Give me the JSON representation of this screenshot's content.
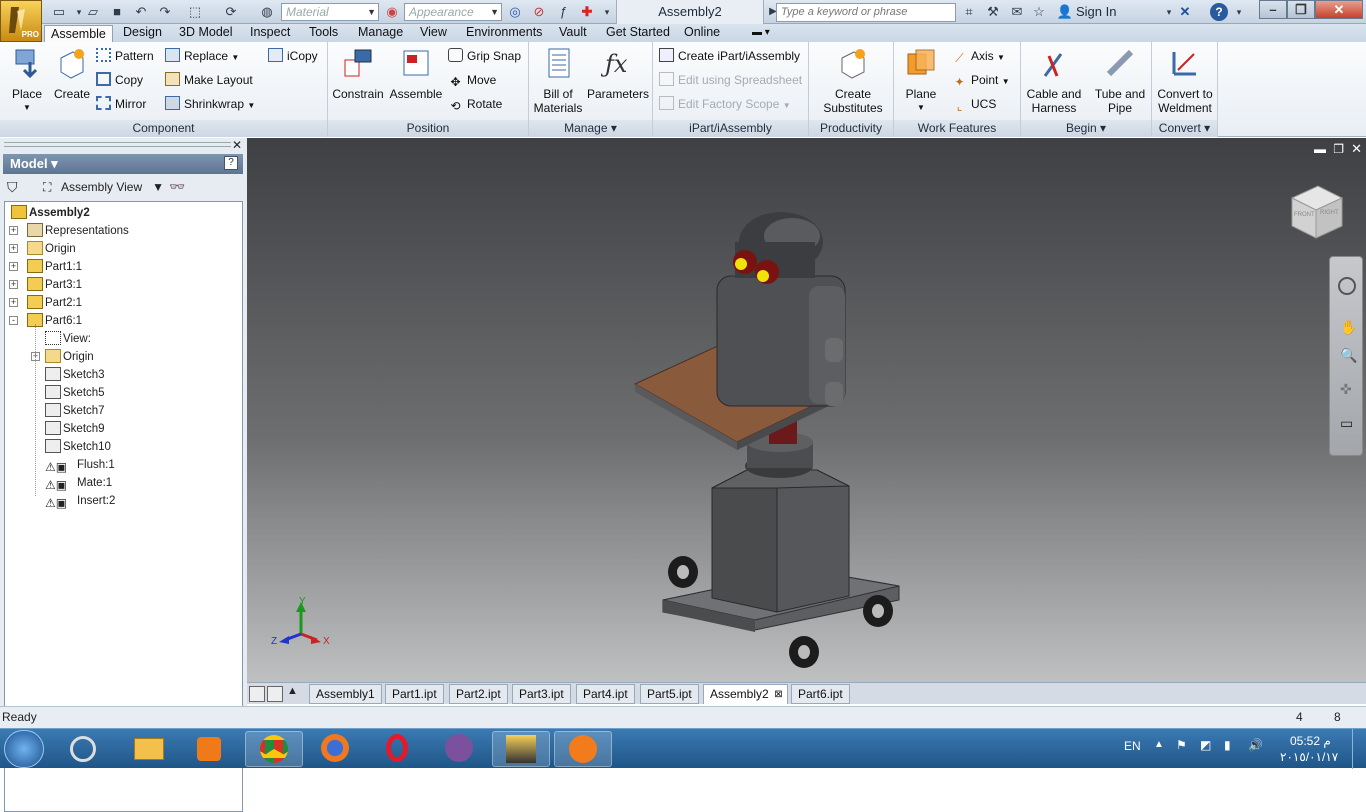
{
  "app": {
    "badge": "PRO"
  },
  "titlebar": {
    "material_placeholder": "Material",
    "appearance_placeholder": "Appearance",
    "document_title": "Assembly2",
    "search_placeholder": "Type a keyword or phrase",
    "sign_in": "Sign In",
    "help": "?"
  },
  "menu_tabs": [
    "Assemble",
    "Design",
    "3D Model",
    "Inspect",
    "Tools",
    "Manage",
    "View",
    "Environments",
    "Vault",
    "Get Started",
    "Online"
  ],
  "active_tab": "Assemble",
  "ribbon": {
    "component": {
      "title": "Component",
      "place": "Place",
      "create": "Create",
      "pattern": "Pattern",
      "copy": "Copy",
      "mirror": "Mirror",
      "replace": "Replace",
      "make_layout": "Make Layout",
      "shrinkwrap": "Shrinkwrap",
      "icopy": "iCopy"
    },
    "position": {
      "title": "Position",
      "constrain": "Constrain",
      "assemble": "Assemble",
      "grip_snap": "Grip Snap",
      "move": "Move",
      "rotate": "Rotate"
    },
    "manage": {
      "title": "Manage",
      "bom_line1": "Bill of",
      "bom_line2": "Materials",
      "parameters": "Parameters"
    },
    "ipart": {
      "title": "iPart/iAssembly",
      "create": "Create iPart/iAssembly",
      "edit_spreadsheet": "Edit using Spreadsheet",
      "edit_factory": "Edit Factory Scope"
    },
    "productivity": {
      "title": "Productivity",
      "line1": "Create",
      "line2": "Substitutes"
    },
    "work_features": {
      "title": "Work Features",
      "plane": "Plane",
      "axis": "Axis",
      "point": "Point",
      "ucs": "UCS"
    },
    "begin": {
      "title": "Begin",
      "cable_line1": "Cable and",
      "cable_line2": "Harness",
      "tube_line1": "Tube and",
      "tube_line2": "Pipe"
    },
    "convert": {
      "title": "Convert",
      "line1": "Convert to",
      "line2": "Weldment"
    }
  },
  "browser": {
    "header": "Model",
    "view_label": "Assembly View",
    "tree": [
      {
        "label": "Assembly2",
        "level": 0,
        "expander": "",
        "icon": "assembly-icon",
        "bold": true
      },
      {
        "label": "Representations",
        "level": 1,
        "expander": "+",
        "icon": "representations-icon"
      },
      {
        "label": "Origin",
        "level": 1,
        "expander": "+",
        "icon": "folder-icon"
      },
      {
        "label": "Part1:1",
        "level": 1,
        "expander": "+",
        "icon": "grounded-part-icon"
      },
      {
        "label": "Part3:1",
        "level": 1,
        "expander": "+",
        "icon": "part-icon"
      },
      {
        "label": "Part2:1",
        "level": 1,
        "expander": "+",
        "icon": "part-icon"
      },
      {
        "label": "Part6:1",
        "level": 1,
        "expander": "-",
        "icon": "part-icon"
      },
      {
        "label": "View:",
        "level": 2,
        "expander": "",
        "icon": "view-icon"
      },
      {
        "label": "Origin",
        "level": 2,
        "expander": "+",
        "icon": "folder-icon"
      },
      {
        "label": "Sketch3",
        "level": 2,
        "expander": "",
        "icon": "sketch-icon"
      },
      {
        "label": "Sketch5",
        "level": 2,
        "expander": "",
        "icon": "sketch-icon"
      },
      {
        "label": "Sketch7",
        "level": 2,
        "expander": "",
        "icon": "sketch-icon"
      },
      {
        "label": "Sketch9",
        "level": 2,
        "expander": "",
        "icon": "sketch-icon"
      },
      {
        "label": "Sketch10",
        "level": 2,
        "expander": "",
        "icon": "sketch-icon"
      },
      {
        "label": "Flush:1",
        "level": 2,
        "expander": "",
        "icon": "warning-constraint-icon"
      },
      {
        "label": "Mate:1",
        "level": 2,
        "expander": "",
        "icon": "warning-constraint-icon"
      },
      {
        "label": "Insert:2",
        "level": 2,
        "expander": "",
        "icon": "warning-constraint-icon"
      }
    ]
  },
  "viewcube": {
    "front": "FRONT",
    "right": "RIGHT"
  },
  "triad": {
    "x": "X",
    "y": "Y",
    "z": "Z"
  },
  "document_tabs": [
    "Assembly1",
    "Part1.ipt",
    "Part2.ipt",
    "Part3.ipt",
    "Part4.ipt",
    "Part5.ipt",
    "Assembly2",
    "Part6.ipt"
  ],
  "active_document": "Assembly2",
  "status": {
    "text": "Ready",
    "count1": "4",
    "count2": "8"
  },
  "taskbar": {
    "lang": "EN",
    "time": "05:52 م",
    "date": "٢٠١٥/٠١/١٧",
    "apps": [
      "windows-start-icon",
      "media-icon",
      "explorer-icon",
      "player-icon",
      "chrome-icon",
      "firefox-icon",
      "opera-icon",
      "viber-icon",
      "inventor-icon",
      "avast-icon"
    ]
  },
  "colors": {
    "accent": "#4a6a92",
    "viewport_top": "#3f4043",
    "viewport_bottom": "#bfc0c1"
  }
}
